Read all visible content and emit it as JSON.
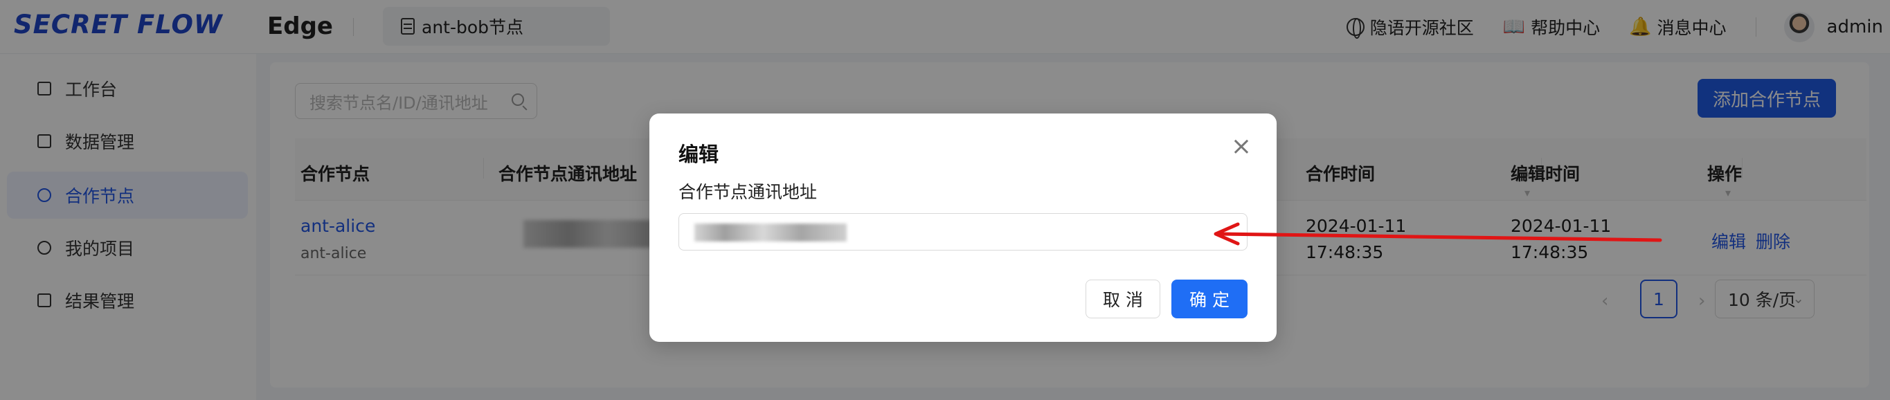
{
  "header": {
    "logo": "SECRET FLOW",
    "brand": "Edge",
    "node_tab": "ant-bob节点",
    "links": [
      {
        "label": "隐语开源社区",
        "icon": "globe-icon"
      },
      {
        "label": "帮助中心",
        "icon": "book-icon"
      },
      {
        "label": "消息中心",
        "icon": "bell-icon"
      }
    ],
    "user": "admin"
  },
  "sidebar": {
    "items": [
      {
        "label": "工作台",
        "icon": "grid-icon",
        "active": false
      },
      {
        "label": "数据管理",
        "icon": "table-icon",
        "active": false
      },
      {
        "label": "合作节点",
        "icon": "globe-icon",
        "active": true
      },
      {
        "label": "我的项目",
        "icon": "project-icon",
        "active": false
      },
      {
        "label": "结果管理",
        "icon": "list-icon",
        "active": false
      }
    ]
  },
  "toolbar": {
    "search_placeholder": "搜索节点名/ID/通讯地址",
    "add_button": "添加合作节点"
  },
  "table": {
    "columns": [
      "合作节点",
      "合作节点通讯地址",
      "合作时间",
      "编辑时间",
      "操作"
    ],
    "rows": [
      {
        "node_name": "ant-alice",
        "node_id": "ant-alice",
        "created_date": "2024-01-11",
        "created_time": "17:48:35",
        "edited_date": "2024-01-11",
        "edited_time": "17:48:35",
        "actions": [
          "编辑",
          "删除"
        ]
      }
    ]
  },
  "pagination": {
    "prev": "‹",
    "current": "1",
    "next": "›",
    "page_size": "10 条/页"
  },
  "modal": {
    "title": "编辑",
    "close": "×",
    "field_label": "合作节点通讯地址",
    "cancel": "取 消",
    "confirm": "确 定"
  },
  "colors": {
    "primary": "#1f5be6",
    "annotation_arrow": "#e01515"
  }
}
